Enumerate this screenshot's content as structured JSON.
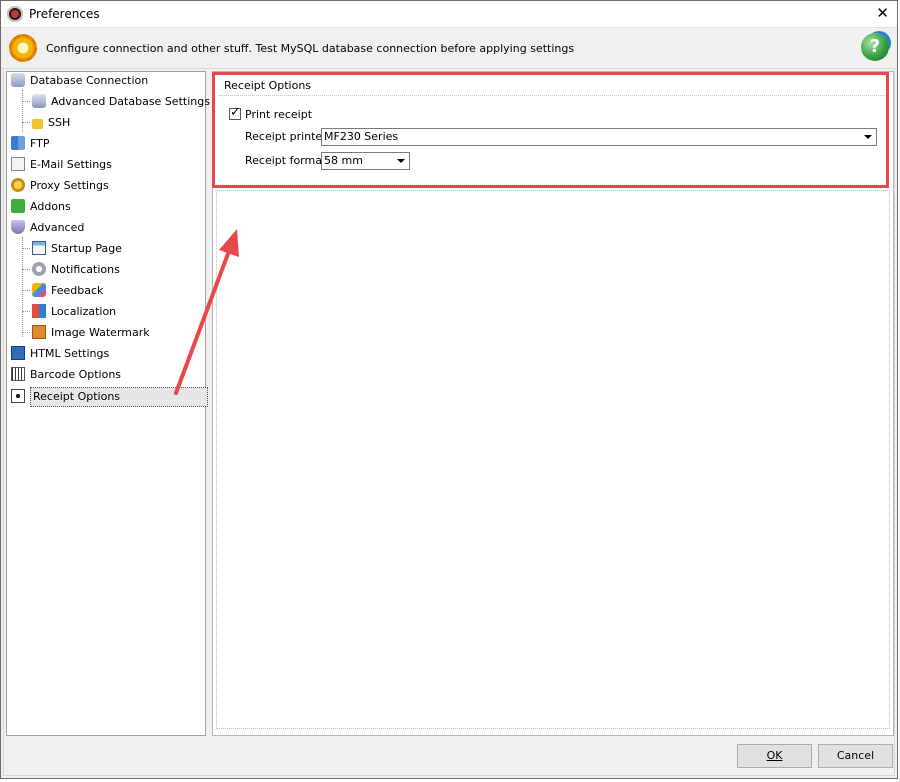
{
  "window": {
    "title": "Preferences",
    "header_text": "Configure connection and other stuff. Test MySQL database connection before applying settings"
  },
  "tree": {
    "items": [
      {
        "label": "Database Connection",
        "icon": "database-icon"
      },
      {
        "label": "Advanced Database Settings",
        "icon": "database-settings-icon"
      },
      {
        "label": "SSH",
        "icon": "lock-icon"
      },
      {
        "label": "FTP",
        "icon": "ftp-icon"
      },
      {
        "label": "E-Mail Settings",
        "icon": "email-icon"
      },
      {
        "label": "Proxy Settings",
        "icon": "proxy-icon"
      },
      {
        "label": "Addons",
        "icon": "puzzle-icon"
      },
      {
        "label": "Advanced",
        "icon": "shield-icon"
      },
      {
        "label": "Startup Page",
        "icon": "startup-page-icon"
      },
      {
        "label": "Notifications",
        "icon": "notification-icon"
      },
      {
        "label": "Feedback",
        "icon": "feedback-icon"
      },
      {
        "label": "Localization",
        "icon": "localization-icon"
      },
      {
        "label": "Image Watermark",
        "icon": "watermark-icon"
      },
      {
        "label": "HTML Settings",
        "icon": "html-icon"
      },
      {
        "label": "Barcode Options",
        "icon": "barcode-icon"
      },
      {
        "label": "Receipt Options",
        "icon": "receipt-icon"
      }
    ],
    "selected": "Receipt Options"
  },
  "receipt": {
    "group_title": "Receipt Options",
    "print_receipt_label": "Print receipt",
    "print_receipt_checked": true,
    "printer_label": "Receipt printer",
    "printer_value": "MF230 Series",
    "format_label": "Receipt format",
    "format_value": "58 mm"
  },
  "buttons": {
    "ok": "OK",
    "cancel": "Cancel"
  },
  "colors": {
    "highlight": "#e8474b",
    "accent": "#1a73c9"
  }
}
